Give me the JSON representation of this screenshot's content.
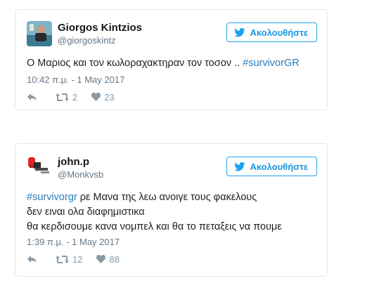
{
  "tweets": [
    {
      "display_name": "Giorgos Kintzios",
      "screen_name": "@giorgoskintz",
      "follow_label": "Ακολουθήστε",
      "text_lines": [
        {
          "prefix": "",
          "plain": "Ο Μαριος και τον κωλοραχακτηραν τον τοσον .. ",
          "hashtag": "#survivorGR"
        }
      ],
      "timestamp": "10:42 π.μ. - 1 May 2017",
      "retweets": "2",
      "likes": "23",
      "icons": {
        "avatar": "avatar-photo",
        "reply": "reply-icon",
        "retweet": "retweet-icon",
        "like": "heart-icon",
        "follow": "twitter-bird-icon"
      }
    },
    {
      "display_name": "john.p",
      "screen_name": "@Monkvsb",
      "follow_label": "Ακολουθήστε",
      "text_lines": [
        {
          "hashtag": "#survivorgr",
          "plain": " ρε Μανα της λεω ανοιγε τους φακελους"
        },
        {
          "plain": "δεν ειναι ολα διαφημιστικα"
        },
        {
          "plain": "θα κερδισουμε κανα νομπελ και θα το πεταξεις να πουμε"
        }
      ],
      "timestamp": "1:39 π.μ. - 1 May 2017",
      "retweets": "12",
      "likes": "88",
      "icons": {
        "avatar": "avatar-photo",
        "reply": "reply-icon",
        "retweet": "retweet-icon",
        "like": "heart-icon",
        "follow": "twitter-bird-icon"
      }
    }
  ],
  "colors": {
    "link": "#2b7bb9",
    "follow_border": "#1da1f2",
    "muted": "#657786",
    "action": "#8899a6",
    "card_border": "#e1e8ed"
  }
}
